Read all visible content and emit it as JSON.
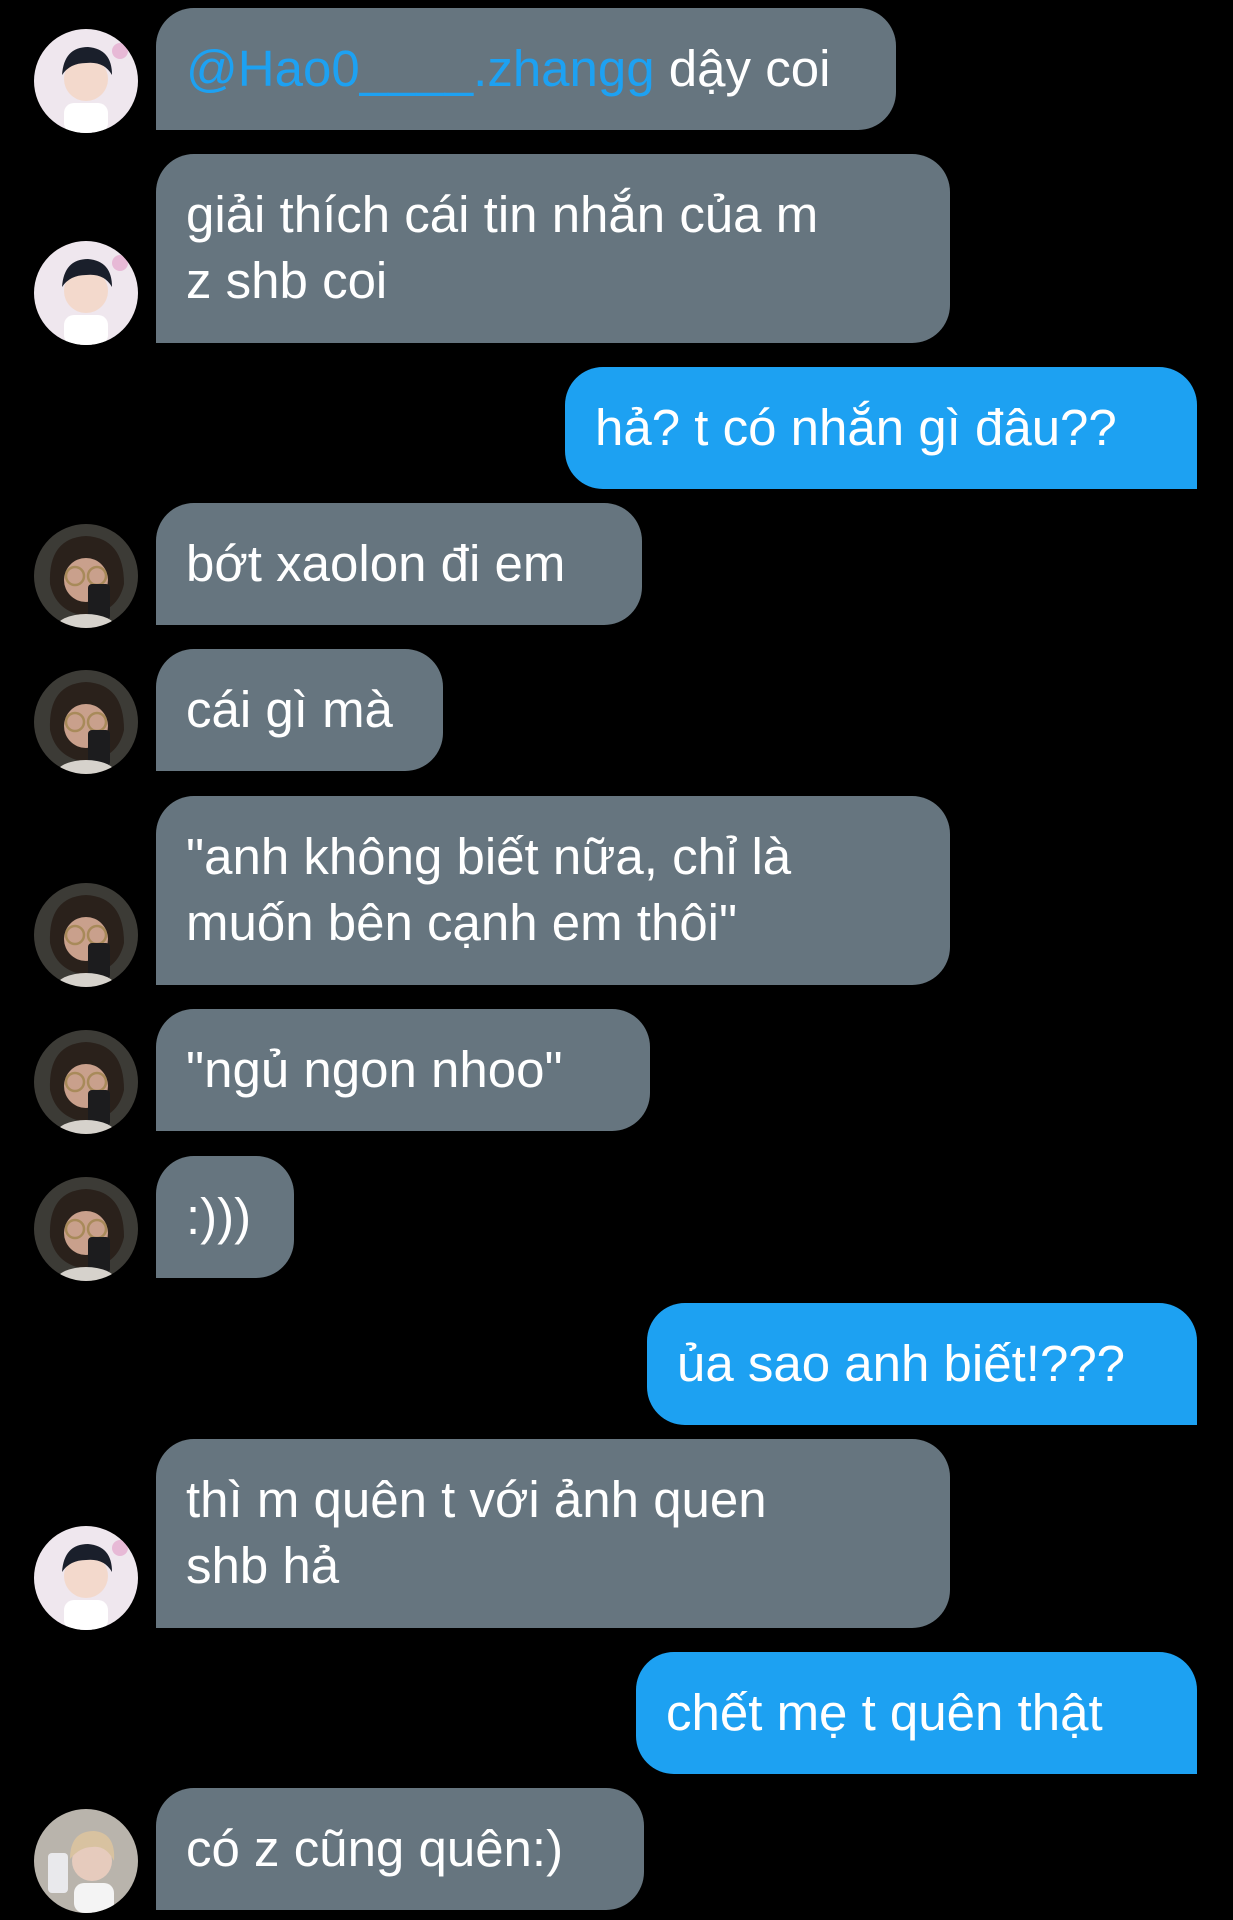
{
  "conversation": {
    "messages": [
      {
        "sender": "other",
        "avatar": "avatar-boy-dark-hair",
        "mention": "@Hao0____.zhangg",
        "text": " dậy coi"
      },
      {
        "sender": "other",
        "avatar": "avatar-boy-dark-hair",
        "lines": [
          "giải thích cái tin nhắn của m",
          "z shb coi"
        ]
      },
      {
        "sender": "me",
        "text": "hả? t có nhắn gì đâu??"
      },
      {
        "sender": "other",
        "avatar": "avatar-glasses-phone",
        "text": "bớt xaolon đi em"
      },
      {
        "sender": "other",
        "avatar": "avatar-glasses-phone",
        "text": "cái gì mà"
      },
      {
        "sender": "other",
        "avatar": "avatar-glasses-phone",
        "lines": [
          "\"anh không biết nữa, chỉ là",
          "muốn bên cạnh em thôi\""
        ]
      },
      {
        "sender": "other",
        "avatar": "avatar-glasses-phone",
        "text": "\"ngủ ngon nhoo\""
      },
      {
        "sender": "other",
        "avatar": "avatar-glasses-phone",
        "text": ":)))"
      },
      {
        "sender": "me",
        "text": "ủa sao anh biết!???"
      },
      {
        "sender": "other",
        "avatar": "avatar-boy-dark-hair",
        "lines": [
          "thì m quên t với ảnh quen",
          "shb hả"
        ]
      },
      {
        "sender": "me",
        "text": "chết mẹ t quên thật"
      },
      {
        "sender": "other",
        "avatar": "avatar-light-hair-selfie",
        "text": "có z cũng quên:)"
      }
    ]
  },
  "colors": {
    "background": "#000000",
    "incoming_bubble": "#66757f",
    "outgoing_bubble": "#1da1f2",
    "mention": "#1da1f2",
    "text": "#ffffff"
  }
}
